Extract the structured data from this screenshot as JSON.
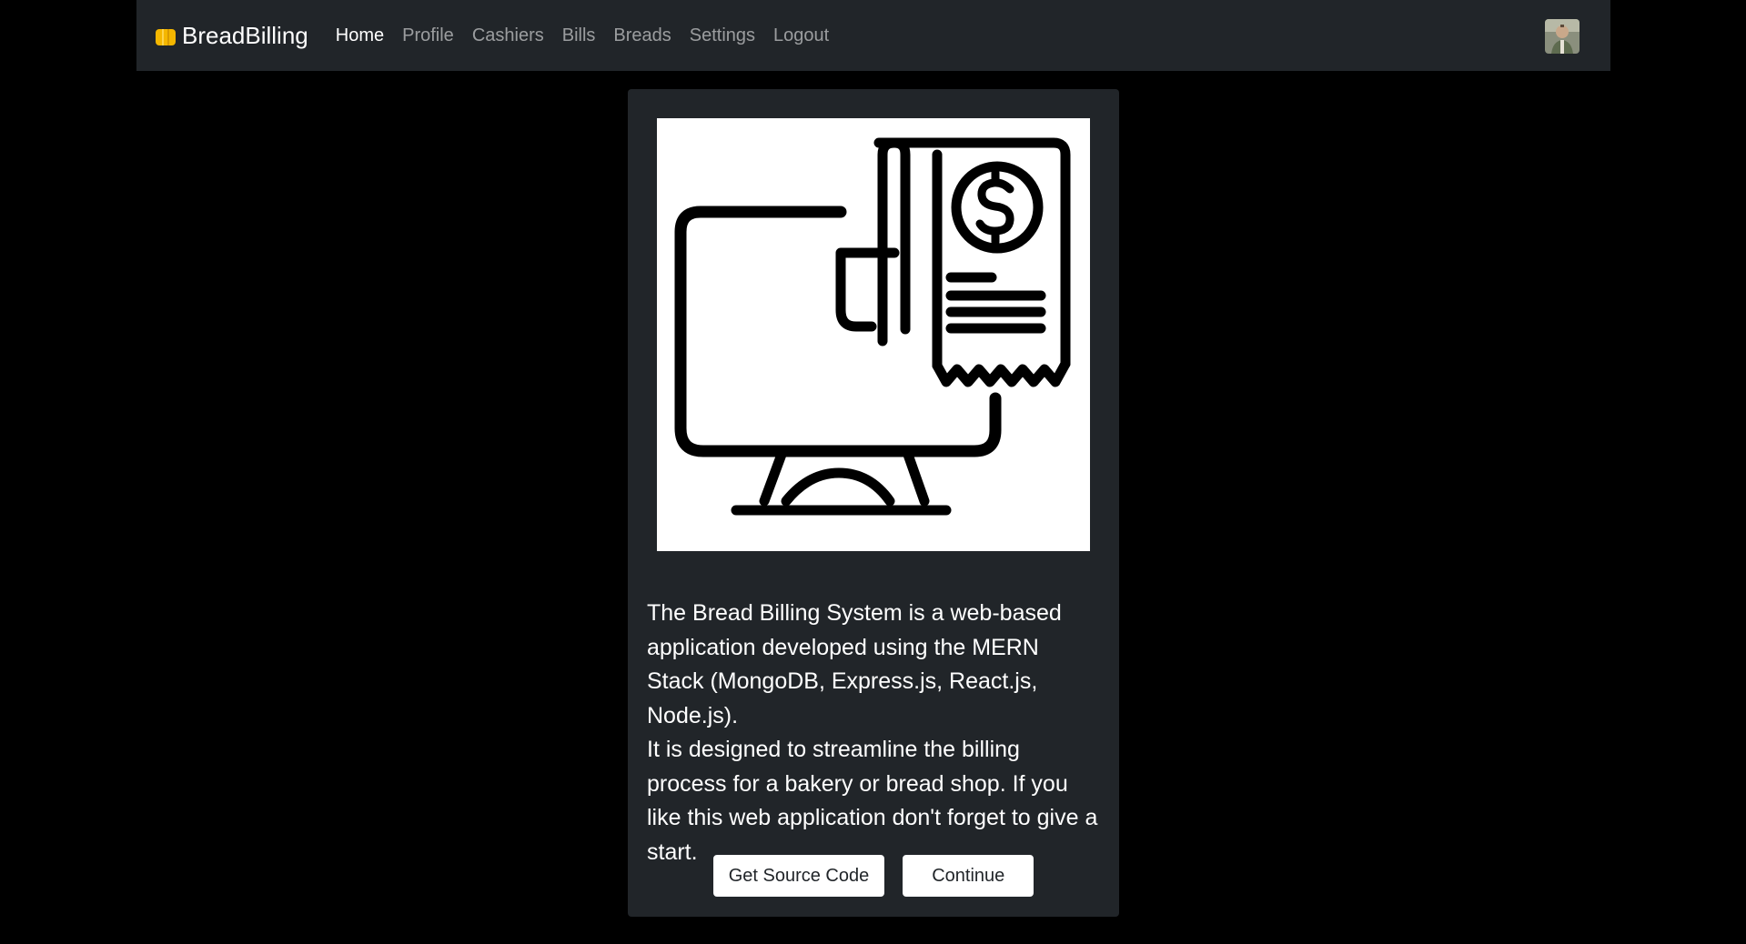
{
  "navbar": {
    "brand": "BreadBilling",
    "brand_icon": "bread-icon",
    "links": [
      {
        "label": "Home",
        "active": true
      },
      {
        "label": "Profile",
        "active": false
      },
      {
        "label": "Cashiers",
        "active": false
      },
      {
        "label": "Bills",
        "active": false
      },
      {
        "label": "Breads",
        "active": false
      },
      {
        "label": "Settings",
        "active": false
      },
      {
        "label": "Logout",
        "active": false
      }
    ],
    "avatar_icon": "user-avatar"
  },
  "card": {
    "image_icon": "monitor-receipt-dollar-icon",
    "paragraphs": [
      "The Bread Billing System is a web-based application developed using the MERN Stack (MongoDB, Express.js, React.js, Node.js).",
      "It is designed to streamline the billing process for a bakery or bread shop. If you like this web application don't forget to give a start."
    ],
    "buttons": {
      "source_code": "Get Source Code",
      "continue": "Continue"
    }
  },
  "colors": {
    "page_background": "#000000",
    "navbar_background": "#212529",
    "card_background": "#212529",
    "brand_icon": "#f5b700",
    "button_background": "#ffffff"
  }
}
